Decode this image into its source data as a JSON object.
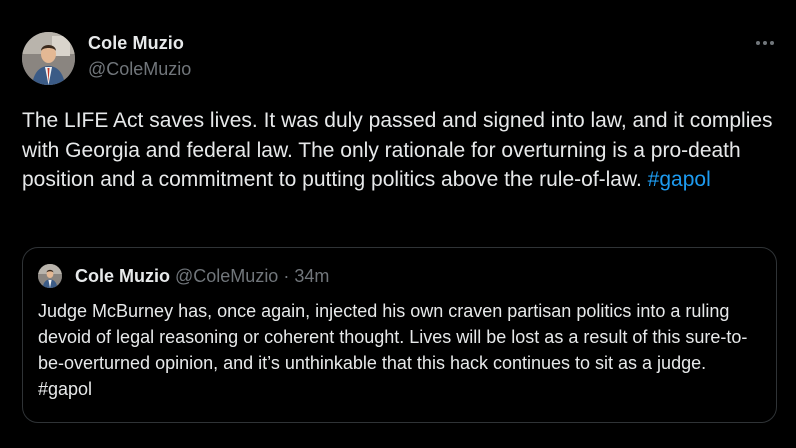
{
  "tweet": {
    "author_name": "Cole Muzio",
    "author_handle": "@ColeMuzio",
    "more_icon": "more-horizontal-icon",
    "text": "The LIFE Act saves lives. It was duly passed and signed into law, and it complies with Georgia and federal law. The only rationale for overturning is a pro-death position and a commitment to putting politics above the rule-of-law. ",
    "hashtag": "#gapol"
  },
  "quoted_tweet": {
    "author_name": "Cole Muzio",
    "author_handle": "@ColeMuzio",
    "separator": " · ",
    "time": "34m",
    "text": "Judge McBurney has, once again, injected his own craven partisan politics into a ruling devoid of legal reasoning or coherent thought. Lives will be lost as a result of this sure-to-be-overturned opinion, and it’s unthinkable that this hack continues to sit as a judge. ",
    "hashtag": "#gapol"
  },
  "colors": {
    "background": "#000000",
    "text": "#e7e9ea",
    "secondary": "#71767b",
    "link": "#1d9bf0",
    "border": "#2f3336"
  }
}
